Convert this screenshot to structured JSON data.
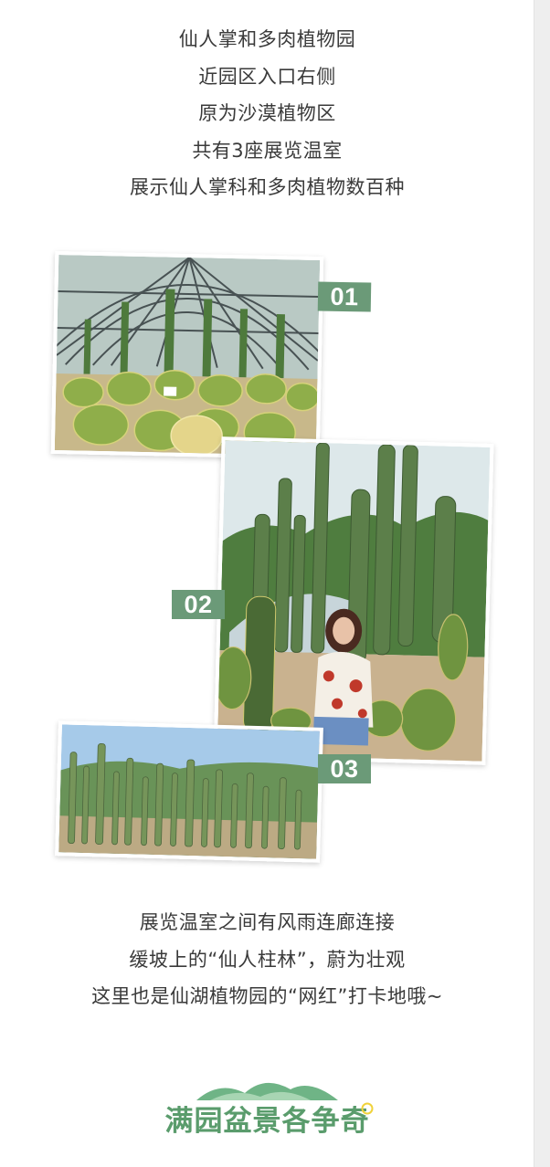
{
  "intro": {
    "lines": [
      "仙人掌和多肉植物园",
      "近园区入口右侧",
      "原为沙漠植物区",
      "共有3座展览温室",
      "展示仙人掌科和多肉植物数百种"
    ]
  },
  "gallery": {
    "badges": [
      "01",
      "02",
      "03"
    ],
    "photo_subjects": [
      "greenhouse-cactus-dome",
      "woman-among-tall-cacti",
      "cactus-forest-slope"
    ]
  },
  "outro": {
    "lines": [
      "展览温室之间有风雨连廊连接",
      "缓坡上的“仙人柱林”，蔚为壮观",
      "这里也是仙湖植物园的“网红”打卡地哦~"
    ]
  },
  "footer": {
    "title": "满园盆景各争奇"
  },
  "colors": {
    "badge": "#6b9a78",
    "footer_title": "#5a9c6c",
    "text": "#333333"
  }
}
